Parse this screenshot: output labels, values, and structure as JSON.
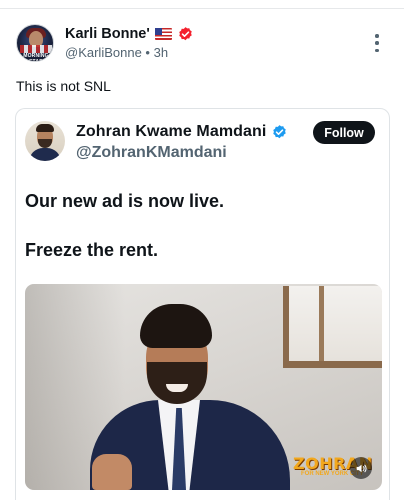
{
  "post": {
    "author": {
      "display_name": "Karli Bonne'",
      "handle": "@KarliBonne",
      "time": "3h",
      "flag_icon": "us-flag-emoji",
      "verified_badge_color": "#f4212e",
      "avatar_text": "MORNING STAR"
    },
    "text": "This is not SNL",
    "more_icon": "more-vertical-icon"
  },
  "quote": {
    "author": {
      "display_name": "Zohran Kwame Mamdani",
      "handle": "@ZohranKMamdani",
      "verified_badge_color": "#1d9bf0"
    },
    "follow_label": "Follow",
    "text_line1": "Our new ad is now live.",
    "text_line2": "Freeze the rent.",
    "video": {
      "brand_text": "ZOHRAN",
      "brand_subtext": "FOR NEW YORK CITY",
      "brand_color": "#f2a81e",
      "mute_icon": "speaker-muted-icon"
    }
  },
  "colors": {
    "text_primary": "#0f1419",
    "text_secondary": "#536471",
    "border": "#dfe3e6",
    "follow_bg": "#0f1419"
  }
}
